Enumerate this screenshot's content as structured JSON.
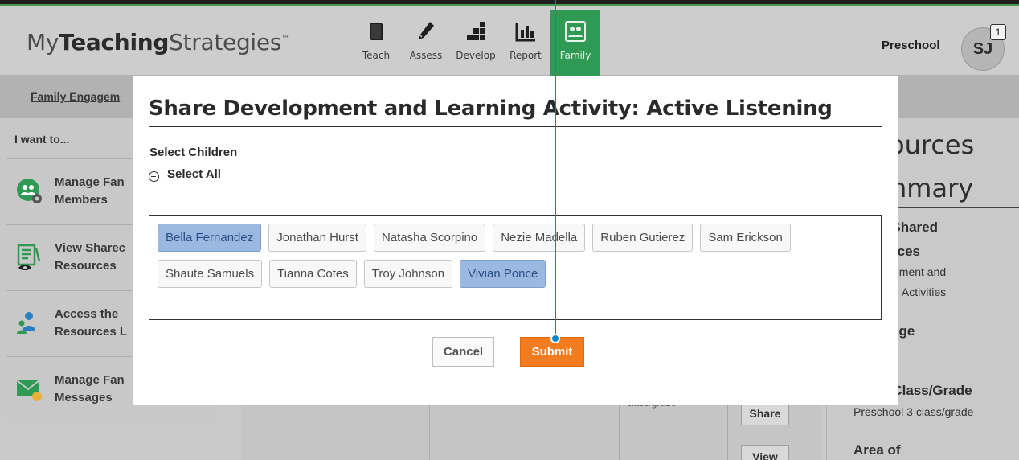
{
  "header": {
    "logo_prefix": "My",
    "logo_bold": "Teaching",
    "logo_suffix": "Strategies",
    "logo_tm": "™",
    "nav": [
      {
        "label": "Teach",
        "icon": "book-icon"
      },
      {
        "label": "Assess",
        "icon": "pencil-icon"
      },
      {
        "label": "Develop",
        "icon": "blocks-icon"
      },
      {
        "label": "Report",
        "icon": "bar-chart-icon"
      },
      {
        "label": "Family",
        "icon": "family-icon",
        "active": true
      }
    ],
    "program": "Preschool",
    "user_initials": "SJ",
    "notification_count": "1"
  },
  "subbar": {
    "breadcrumb": "Family Engagem"
  },
  "sidebar": {
    "heading": "I want to...",
    "items": [
      {
        "line1": "Manage Fan",
        "line2": "Members",
        "icon": "manage-family-icon"
      },
      {
        "line1": "View Sharec",
        "line2": "Resources",
        "icon": "view-resources-icon"
      },
      {
        "line1": "Access the",
        "line2": "Resources L",
        "icon": "access-library-icon"
      },
      {
        "line1": "Manage Fan",
        "line2": "Messages",
        "icon": "messages-icon"
      }
    ]
  },
  "main": {
    "table_note": "class/grade",
    "share_button": "Share",
    "view_button": "View"
  },
  "right_panel": {
    "title_line1": "ources",
    "title_line2": "nmary",
    "shared_label_1": ": Shared",
    "shared_label_2": "rces",
    "shared_value_1": "oment and",
    "shared_value_2": "g Activities",
    "age_label": "age",
    "class_label": "r Class/Grade",
    "class_value": "Preschool 3 class/grade",
    "area_label": "Area of"
  },
  "modal": {
    "title": "Share Development and Learning Activity: Active Listening",
    "select_children_label": "Select Children",
    "select_all_label": "Select All",
    "children_rows": [
      [
        {
          "name": "Bella Fernandez",
          "selected": true
        },
        {
          "name": "Jonathan Hurst",
          "selected": false
        },
        {
          "name": "Natasha Scorpino",
          "selected": false
        },
        {
          "name": "Nezie Madella",
          "selected": false
        },
        {
          "name": "Ruben Gutierez",
          "selected": false
        },
        {
          "name": "Sam Erickson",
          "selected": false
        }
      ],
      [
        {
          "name": "Shaute Samuels",
          "selected": false
        },
        {
          "name": "Tianna Cotes",
          "selected": false
        },
        {
          "name": "Troy Johnson",
          "selected": false
        },
        {
          "name": "Vivian Ponce",
          "selected": true
        }
      ]
    ],
    "cancel_label": "Cancel",
    "submit_label": "Submit"
  },
  "colors": {
    "accent_green": "#2e9a53",
    "submit_orange": "#f47c20",
    "chip_selected": "#9bb9e0",
    "pointer_blue": "#0a86c6"
  }
}
